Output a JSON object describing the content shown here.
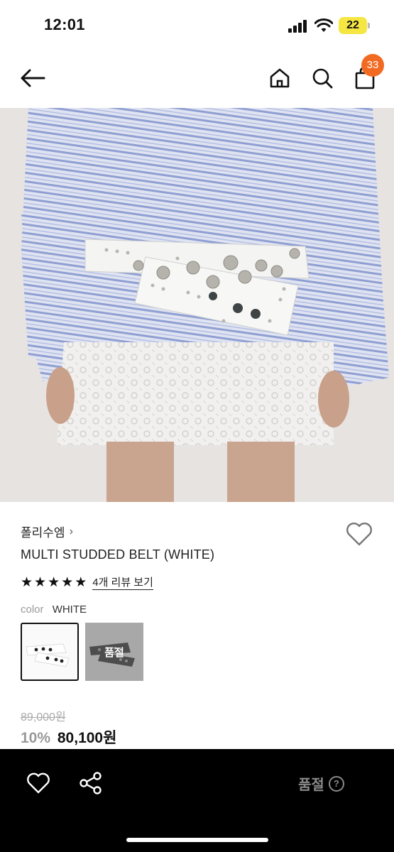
{
  "status_bar": {
    "time": "12:01",
    "battery": "22",
    "icons": [
      "signal-icon",
      "wifi-icon",
      "battery-icon"
    ]
  },
  "nav": {
    "icons": [
      "back-arrow-icon",
      "home-icon",
      "search-icon",
      "shopping-bag-icon"
    ],
    "cart_count": "33"
  },
  "product": {
    "brand": "폴리수엠",
    "brand_chevron": "›",
    "name": "MULTI STUDDED BELT (WHITE)",
    "rating_stars": 5,
    "review_link": "4개 리뷰 보기",
    "color_label": "color",
    "color_value": "WHITE",
    "swatches": [
      {
        "name": "white",
        "selected": true,
        "sold_out": false
      },
      {
        "name": "black",
        "selected": false,
        "sold_out": true,
        "badge": "품절"
      }
    ],
    "original_price": "89,000원",
    "discount": "10%",
    "price": "80,100원"
  },
  "bottom_bar": {
    "soldout_label": "품절",
    "help_symbol": "?",
    "icons": [
      "heart-icon",
      "share-icon",
      "help-icon"
    ]
  },
  "colors": {
    "badge": "#f26a21",
    "battery": "#f5e642",
    "bottom_bar": "#000000",
    "disabled_text": "#8a8a8a"
  }
}
